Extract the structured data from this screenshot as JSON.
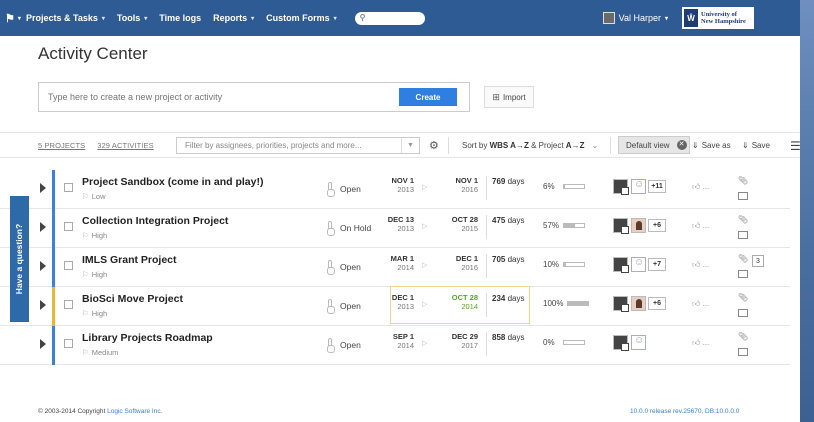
{
  "nav": {
    "logo_icon": "flag-icon",
    "items": [
      {
        "label": "Projects & Tasks"
      },
      {
        "label": "Tools"
      },
      {
        "label": "Time logs"
      },
      {
        "label": "Reports"
      },
      {
        "label": "Custom Forms"
      }
    ],
    "user_name": "Val Harper",
    "org_line1": "University of",
    "org_line2": "New Hampshire"
  },
  "page": {
    "title": "Activity Center"
  },
  "create": {
    "placeholder": "Type here to create a new project or activity",
    "button_label": "Create",
    "import_label": "Import"
  },
  "toolbar": {
    "projects_count": "5 PROJECTS",
    "activities_count": "329 ACTIVITIES",
    "filter_placeholder": "Filter by assignees, priorities, projects and more...",
    "sort_prefix": "Sort by",
    "sort_key1": "WBS A→Z",
    "sort_amp": "&",
    "sort_key2": "Project",
    "sort_key2_order": "A→Z",
    "default_view": "Default view",
    "save_as": "Save as",
    "save": "Save"
  },
  "projects": [
    {
      "name": "Project Sandbox (come in and play!)",
      "priority": "Low",
      "status": "Open",
      "start_md": "NOV 1",
      "start_y": "2013",
      "end_md": "NOV 1",
      "end_y": "2016",
      "days": "769",
      "days_unit": "days",
      "progress": "6%",
      "progress_value": 6,
      "extra": "+11",
      "bar_color": "#3a84d6"
    },
    {
      "name": "Collection Integration Project",
      "priority": "High",
      "status": "On Hold",
      "start_md": "DEC 13",
      "start_y": "2013",
      "end_md": "OCT 28",
      "end_y": "2015",
      "days": "475",
      "days_unit": "days",
      "progress": "57%",
      "progress_value": 57,
      "extra": "+6",
      "bar_color": "#3a84d6"
    },
    {
      "name": "IMLS Grant Project",
      "priority": "High",
      "status": "Open",
      "start_md": "MAR 1",
      "start_y": "2014",
      "end_md": "DEC 1",
      "end_y": "2016",
      "days": "705",
      "days_unit": "days",
      "progress": "10%",
      "progress_value": 10,
      "extra": "+7",
      "comment_count": "3",
      "bar_color": "#3a84d6"
    },
    {
      "name": "BioSci Move Project",
      "priority": "High",
      "status": "Open",
      "start_md": "DEC 1",
      "start_y": "2013",
      "end_md": "OCT 28",
      "end_y": "2014",
      "days": "234",
      "days_unit": "days",
      "progress": "100%",
      "progress_value": 100,
      "extra": "+6",
      "bar_color": "#e8b92e",
      "end_color": "#5aa62e"
    },
    {
      "name": "Library Projects Roadmap",
      "priority": "Medium",
      "status": "Open",
      "start_md": "SEP 1",
      "start_y": "2014",
      "end_md": "DEC 29",
      "end_y": "2017",
      "days": "858",
      "days_unit": "days",
      "progress": "0%",
      "progress_value": 0,
      "bar_color": "#3a84d6"
    }
  ],
  "like_text": "...",
  "side_tab": "Have a question?",
  "footer": {
    "copyright": "© 2003-2014 Copyright",
    "company": "Logic Software Inc.",
    "version": "10.0.0 release rev.25670, DB:10.0.0.0"
  }
}
